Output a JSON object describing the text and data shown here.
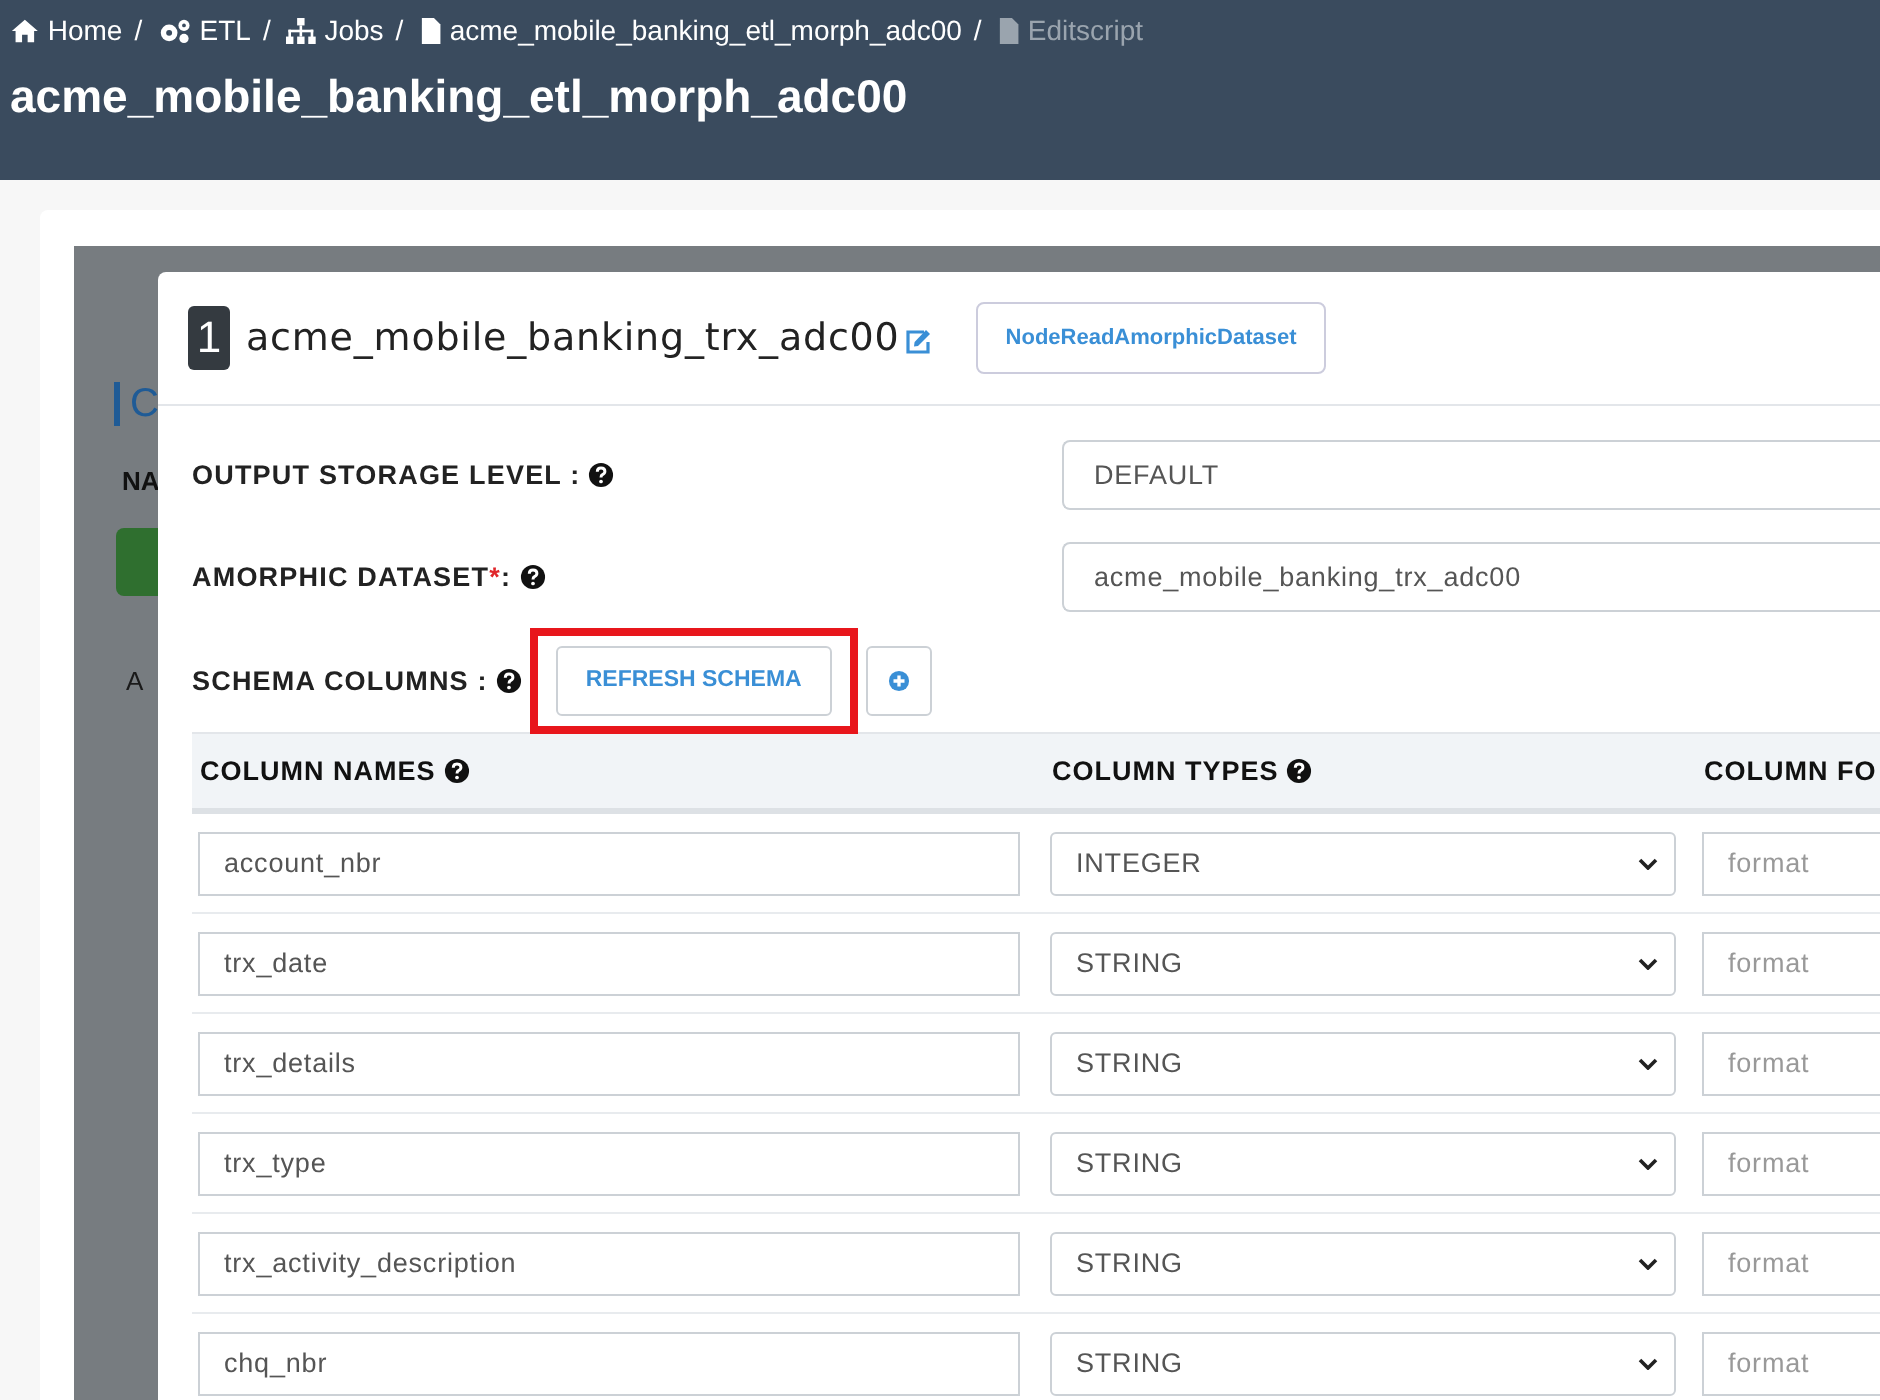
{
  "breadcrumb": {
    "separator": "/",
    "items": [
      {
        "label": "Home",
        "kind": "home",
        "current": false
      },
      {
        "label": "ETL",
        "kind": "gears",
        "current": false
      },
      {
        "label": "Jobs",
        "kind": "hierarchy",
        "current": false
      },
      {
        "label": "acme_mobile_banking_etl_morph_adc00",
        "kind": "file",
        "current": false
      },
      {
        "label": "Editscript",
        "kind": "file",
        "current": true
      }
    ]
  },
  "page_title": "acme_mobile_banking_etl_morph_adc00",
  "backdrop": {
    "heading": "C",
    "label": "NA",
    "tab": "A"
  },
  "modal": {
    "number": "1",
    "title": "acme_mobile_banking_trx_adc00",
    "node_type_button": "NodeReadAmorphicDataset",
    "fields": [
      {
        "label": "OUTPUT STORAGE LEVEL :",
        "value": "DEFAULT"
      },
      {
        "label": "AMORPHIC DATASET",
        "required": true,
        "required_mark": "*",
        "suffix": ":",
        "value": "acme_mobile_banking_trx_adc00"
      }
    ],
    "schema": {
      "label": "SCHEMA COLUMNS :",
      "refresh_button": "REFRESH SCHEMA",
      "highlighted": true
    },
    "table": {
      "columns": [
        {
          "label": "COLUMN NAMES"
        },
        {
          "label": "COLUMN TYPES"
        },
        {
          "label": "COLUMN FO"
        }
      ],
      "rows": [
        {
          "name": "account_nbr",
          "type": "INTEGER",
          "format_placeholder": "format"
        },
        {
          "name": "trx_date",
          "type": "STRING",
          "format_placeholder": "format"
        },
        {
          "name": "trx_details",
          "type": "STRING",
          "format_placeholder": "format"
        },
        {
          "name": "trx_type",
          "type": "STRING",
          "format_placeholder": "format"
        },
        {
          "name": "trx_activity_description",
          "type": "STRING",
          "format_placeholder": "format"
        },
        {
          "name": "chq_nbr",
          "type": "STRING",
          "format_placeholder": "format"
        }
      ]
    }
  }
}
